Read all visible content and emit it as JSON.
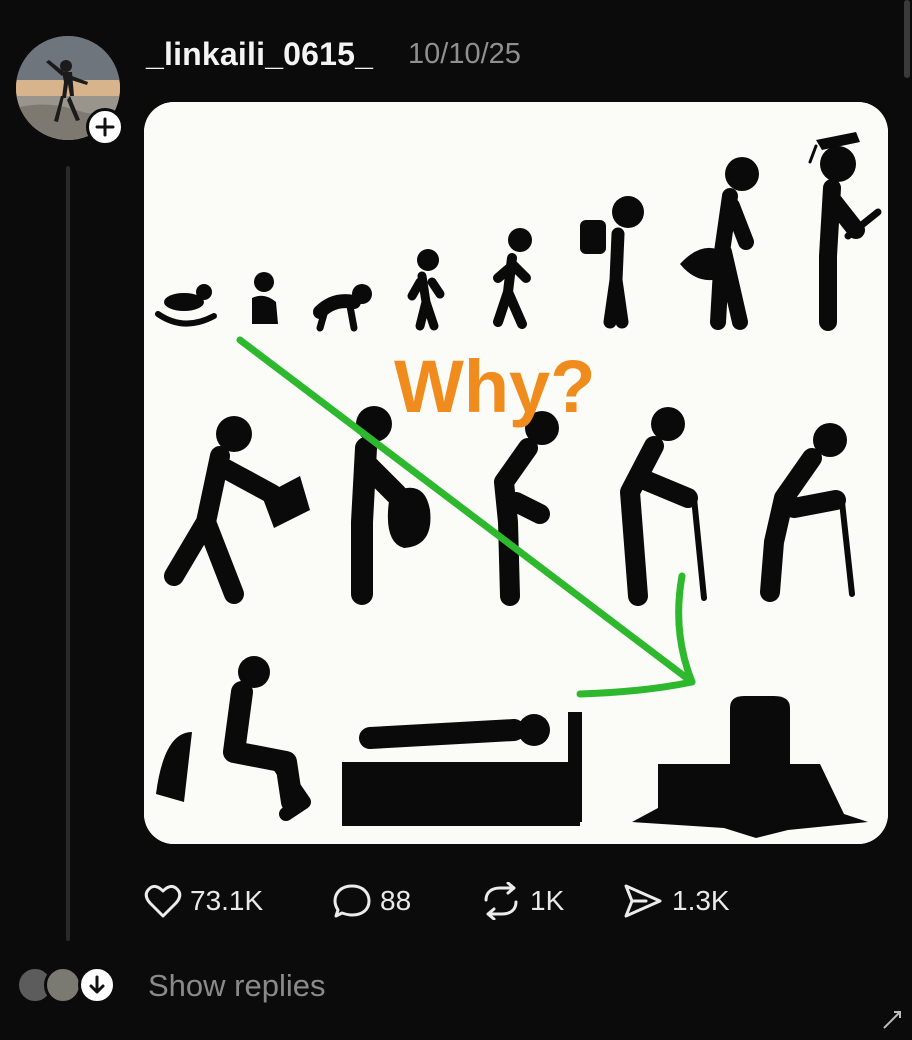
{
  "post": {
    "username": "_linkaili_0615_",
    "timestamp": "10/10/25",
    "image_text": "Why?"
  },
  "actions": {
    "likes": "73.1K",
    "comments": "88",
    "reposts": "1K",
    "shares": "1.3K"
  },
  "replies": {
    "label": "Show replies"
  },
  "colors": {
    "background": "#0b0b0b",
    "why_text": "#f08c1e",
    "arrow": "#2db82d"
  }
}
